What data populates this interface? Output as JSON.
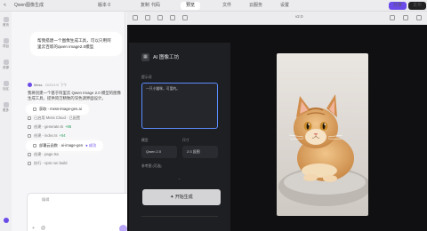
{
  "topbar": {
    "back_glyph": "<",
    "project_title": "Qwen图像生成",
    "history_label": "版本 0",
    "copy_label": "复制",
    "tabs": [
      {
        "label": "代码"
      },
      {
        "label": "预览"
      },
      {
        "label": "文件"
      },
      {
        "label": "云服务"
      },
      {
        "label": "设置"
      }
    ],
    "share_label": "分享",
    "publish_label": "发布"
  },
  "rail": {
    "items": [
      {
        "label": "首页"
      },
      {
        "label": "项目"
      },
      {
        "label": "资源"
      },
      {
        "label": "社区"
      },
      {
        "label": "更多"
      }
    ]
  },
  "chat": {
    "user_message": "帮我搭建一个图像生成工具，可以只用阿里云百炼的qwen image2.0模型",
    "agent_name": "Mess",
    "agent_time": "2025/1/5 下午",
    "agent_text": "我将创建一个基于阿里云 Qwen Image 2.0 模型的图像生成工具，提供简洁精致的深色调界面设计。",
    "steps": [
      {
        "label": "获取 - mess-image-gen.ai",
        "highlight": true,
        "tag": "",
        "tag2": ""
      },
      {
        "label": "已启用 Mess Cloud · 已配置",
        "highlight": false,
        "tag": "",
        "tag2": ""
      },
      {
        "label": "创建 - generate.ts",
        "highlight": false,
        "tag": "",
        "tag2": "+86"
      },
      {
        "label": "创建 - index.ts",
        "highlight": false,
        "tag": "",
        "tag2": "+84"
      },
      {
        "label": "部署云函数 · ai-image-gen",
        "highlight": true,
        "tag": "● 成功",
        "tag2": ""
      },
      {
        "label": "创建 - page.tsx",
        "highlight": false,
        "tag": "",
        "tag2": ""
      },
      {
        "label": "执行 - npm run build",
        "highlight": false,
        "tag": "",
        "tag2": ""
      }
    ],
    "composer_placeholder": "编辑"
  },
  "editor": {
    "version_label": "v2.0"
  },
  "app": {
    "logo_glyph": "▦",
    "title": "AI 图像工坊",
    "prompt_label": "提示词",
    "prompt_value": "一只小猫咪，可爱的。",
    "model_label": "模型",
    "model_value": "Qwen 2.0",
    "size_label": "尺寸",
    "size_value": "2:3 竖图",
    "extra_label": "参考图 (可选)",
    "generate_label": "✦ 开始生成",
    "expand_glyph": "⌄"
  },
  "colors": {
    "accent": "#6b4be8",
    "preview_bg": "#101012",
    "card_bg": "#1e1f23",
    "focus": "#5b8cff"
  }
}
